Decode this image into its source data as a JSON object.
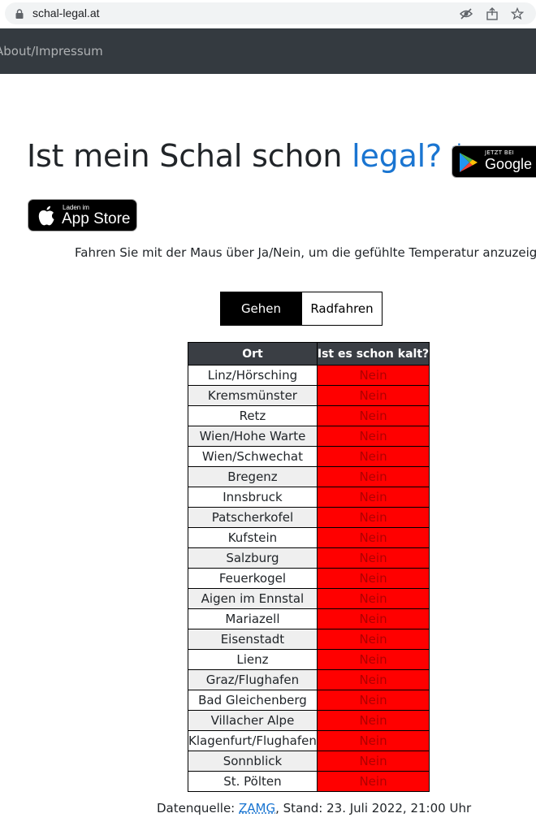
{
  "browser": {
    "url": "schal-legal.at"
  },
  "navbar": {
    "link_label": "About/Impressum"
  },
  "heading": {
    "main": "Ist mein Schal schon ",
    "accent": "legal?",
    "asterisk": " *",
    "accent_color": "#1a75d1"
  },
  "badges": {
    "google_small": "JETZT BEI",
    "google_big": "Google Play",
    "apple_small": "Laden im",
    "apple_big": "App Store"
  },
  "hint": "Fahren Sie mit der Maus über Ja/Nein, um die gefühlte Temperatur anzuzeigen.",
  "toggle": {
    "active": "Gehen",
    "inactive": "Radfahren"
  },
  "table": {
    "headers": [
      "Ort",
      "Ist es schon kalt?"
    ],
    "status_color": "#ff0000",
    "rows": [
      {
        "ort": "Linz/Hörsching",
        "val": "Nein"
      },
      {
        "ort": "Kremsmünster",
        "val": "Nein"
      },
      {
        "ort": "Retz",
        "val": "Nein"
      },
      {
        "ort": "Wien/Hohe Warte",
        "val": "Nein"
      },
      {
        "ort": "Wien/Schwechat",
        "val": "Nein"
      },
      {
        "ort": "Bregenz",
        "val": "Nein"
      },
      {
        "ort": "Innsbruck",
        "val": "Nein"
      },
      {
        "ort": "Patscherkofel",
        "val": "Nein"
      },
      {
        "ort": "Kufstein",
        "val": "Nein"
      },
      {
        "ort": "Salzburg",
        "val": "Nein"
      },
      {
        "ort": "Feuerkogel",
        "val": "Nein"
      },
      {
        "ort": "Aigen im Ennstal",
        "val": "Nein"
      },
      {
        "ort": "Mariazell",
        "val": "Nein"
      },
      {
        "ort": "Eisenstadt",
        "val": "Nein"
      },
      {
        "ort": "Lienz",
        "val": "Nein"
      },
      {
        "ort": "Graz/Flughafen",
        "val": "Nein"
      },
      {
        "ort": "Bad Gleichenberg",
        "val": "Nein"
      },
      {
        "ort": "Villacher Alpe",
        "val": "Nein"
      },
      {
        "ort": "Klagenfurt/Flughafen",
        "val": "Nein"
      },
      {
        "ort": "Sonnblick",
        "val": "Nein"
      },
      {
        "ort": "St. Pölten",
        "val": "Nein"
      }
    ]
  },
  "source": {
    "prefix": "Datenquelle: ",
    "link": "ZAMG",
    "suffix": ", Stand: 23. Juli 2022, 21:00 Uhr"
  }
}
